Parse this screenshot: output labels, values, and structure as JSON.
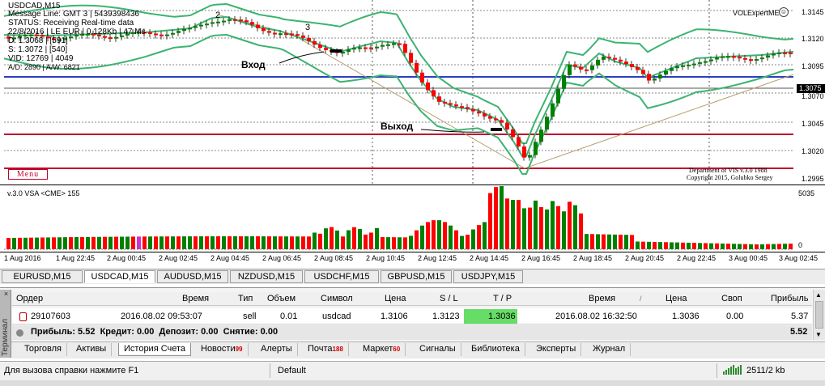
{
  "chart": {
    "symbol_header": "USDCAD,M15",
    "info": [
      "Message Line: GMT 3 | 5439398436",
      "STATUS:  Receiving Real-time data",
      "22/8/2016 | LE EUR | 0.128Kb | 47 Ms",
      "D: 1.3068 | [591]",
      "S: 1.3072 | [540]",
      "VID: 12769 | 4049",
      "A/D: 2890 | A/W: 6821"
    ],
    "expert_name": "VOLExpertME",
    "expert_status_icon": "smiley-icon",
    "menu_label": "Menu",
    "copyright_line1": "Department of VIS v.3.0 1988",
    "copyright_line2": "Copyright 2015, Golubko Sergey",
    "entry_label": "Вход",
    "exit_label": "Выход",
    "wave_mark_2": "2",
    "wave_mark_3": "3",
    "price_labels": [
      "1.3145",
      "1.3120",
      "1.3095",
      "1.3070",
      "1.3045",
      "1.3020",
      "1.2995"
    ],
    "current_price": "1.3075",
    "bull_color": "#008000",
    "bear_color": "#ff0000",
    "band_color": "#3cb371",
    "level_color": "#c0002a",
    "level_blue_color": "#2b3fc0"
  },
  "volume": {
    "label": "v.3.0 VSA <CME> 155",
    "max_label": "5035",
    "zero_label": "0"
  },
  "time_axis": [
    "1 Aug 2016",
    "1 Aug 22:45",
    "2 Aug 00:45",
    "2 Aug 02:45",
    "2 Aug 04:45",
    "2 Aug 06:45",
    "2 Aug 08:45",
    "2 Aug 10:45",
    "2 Aug 12:45",
    "2 Aug 14:45",
    "2 Aug 16:45",
    "2 Aug 18:45",
    "2 Aug 20:45",
    "2 Aug 22:45",
    "3 Aug 00:45",
    "3 Aug 02:45"
  ],
  "symbol_tabs": [
    "EURUSD,M15",
    "USDCAD,M15",
    "AUDUSD,M15",
    "NZDUSD,M15",
    "USDCHF,M15",
    "GBPUSD,M15",
    "USDJPY,M15"
  ],
  "active_symbol_tab": "USDCAD,M15",
  "terminal": {
    "side_label": "Терминал",
    "columns": [
      "Ордер",
      "Время",
      "Тип",
      "Объем",
      "Символ",
      "Цена",
      "S / L",
      "T / P",
      "Время",
      "Цена",
      "Своп",
      "Прибыль"
    ],
    "row": {
      "order": "29107603",
      "open_time": "2016.08.02 09:53:07",
      "type": "sell",
      "volume": "0.01",
      "symbol": "usdcad",
      "open_price": "1.3106",
      "sl": "1.3123",
      "tp": "1.3036",
      "close_time": "2016.08.02 16:32:50",
      "close_price": "1.3036",
      "swap": "0.00",
      "profit": "5.37"
    },
    "summary": "Прибыль: 5.52  Кредит: 0.00  Депозит: 0.00  Снятие: 0.00",
    "summary_total": "5.52",
    "tabs": [
      {
        "label": "Торговля",
        "badge": ""
      },
      {
        "label": "Активы",
        "badge": ""
      },
      {
        "label": "История Счета",
        "badge": ""
      },
      {
        "label": "Новости",
        "badge": "99"
      },
      {
        "label": "Алерты",
        "badge": ""
      },
      {
        "label": "Почта",
        "badge": "188"
      },
      {
        "label": "Маркет",
        "badge": "60"
      },
      {
        "label": "Сигналы",
        "badge": ""
      },
      {
        "label": "Библиотека",
        "badge": ""
      },
      {
        "label": "Эксперты",
        "badge": ""
      },
      {
        "label": "Журнал",
        "badge": ""
      }
    ],
    "active_tab": "История Счета",
    "tp_highlight_color": "#66dd66"
  },
  "status_bar": {
    "help_text": "Для вызова справки нажмите F1",
    "profile": "Default",
    "traffic": "2511/2 kb",
    "connection_icon": "connection-bars-icon"
  }
}
